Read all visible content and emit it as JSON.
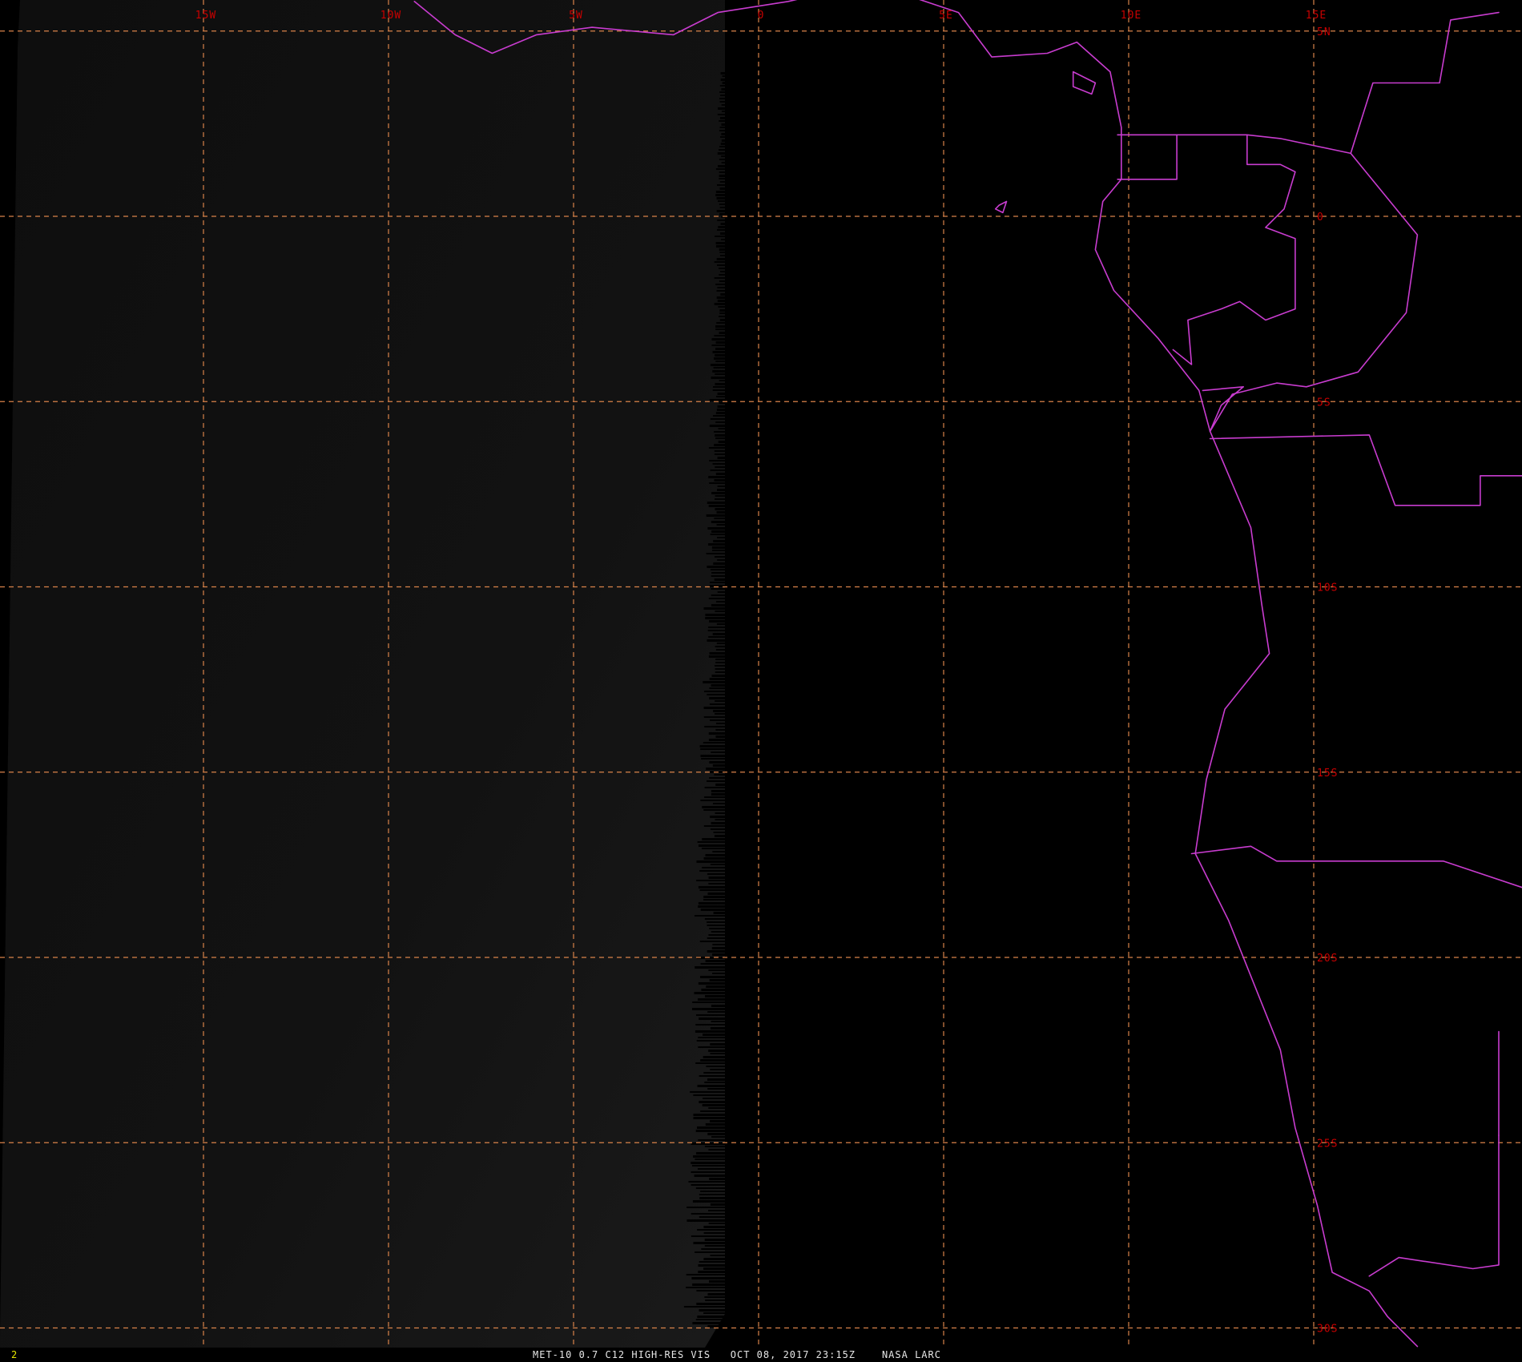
{
  "viewer": {
    "frame_number": "2",
    "caption": {
      "product": "MET-10 0.7 C12 HIGH-RES VIS",
      "datetime": "OCT 08, 2017 23:15Z",
      "source": "NASA LARC"
    }
  },
  "map": {
    "longitude_lines": [
      {
        "value": -15,
        "label": "15W"
      },
      {
        "value": -10,
        "label": "10W"
      },
      {
        "value": -5,
        "label": "5W"
      },
      {
        "value": 0,
        "label": "0"
      },
      {
        "value": 5,
        "label": "5E"
      },
      {
        "value": 10,
        "label": "10E"
      },
      {
        "value": 15,
        "label": "15E"
      }
    ],
    "latitude_lines": [
      {
        "value": 5,
        "label": "5N"
      },
      {
        "value": 0,
        "label": "0"
      },
      {
        "value": -5,
        "label": "5S"
      },
      {
        "value": -10,
        "label": "10S"
      },
      {
        "value": -15,
        "label": "15S"
      },
      {
        "value": -20,
        "label": "20S"
      },
      {
        "value": -25,
        "label": "25S"
      },
      {
        "value": -30,
        "label": "30S"
      }
    ],
    "colors": {
      "background": "#000000",
      "grid_line": "#d9834a",
      "grid_label": "#c80000",
      "boundary": "#c83ccf",
      "night_terminator": "#141414",
      "footer_text": "#e6e6e6",
      "frame_number": "#e6e600"
    },
    "boundaries": [
      {
        "name": "west-africa-coast",
        "points": [
          [
            -9.3,
            5.8
          ],
          [
            -8.2,
            4.9
          ],
          [
            -7.2,
            4.4
          ],
          [
            -6.0,
            4.9
          ],
          [
            -4.5,
            5.1
          ],
          [
            -2.3,
            4.9
          ],
          [
            -1.1,
            5.5
          ],
          [
            0.8,
            5.8
          ],
          [
            3.0,
            6.3
          ],
          [
            5.4,
            5.5
          ],
          [
            6.3,
            4.3
          ],
          [
            7.8,
            4.4
          ],
          [
            8.6,
            4.7
          ],
          [
            9.5,
            3.9
          ],
          [
            9.8,
            2.4
          ],
          [
            9.8,
            1.0
          ],
          [
            9.3,
            0.4
          ],
          [
            9.1,
            -0.9
          ],
          [
            9.6,
            -2.0
          ],
          [
            10.8,
            -3.3
          ],
          [
            11.9,
            -4.7
          ],
          [
            12.2,
            -5.8
          ],
          [
            13.3,
            -8.4
          ],
          [
            13.6,
            -10.5
          ],
          [
            13.8,
            -11.8
          ],
          [
            12.6,
            -13.3
          ],
          [
            12.1,
            -15.2
          ],
          [
            11.8,
            -17.2
          ],
          [
            12.7,
            -19.0
          ],
          [
            14.1,
            -22.5
          ],
          [
            14.5,
            -24.6
          ],
          [
            15.1,
            -26.7
          ],
          [
            15.5,
            -28.5
          ],
          [
            16.5,
            -29.0
          ],
          [
            17.0,
            -29.7
          ],
          [
            17.8,
            -30.5
          ]
        ]
      },
      {
        "name": "bioko-island",
        "points": [
          [
            8.5,
            3.9
          ],
          [
            9.1,
            3.6
          ],
          [
            9.0,
            3.3
          ],
          [
            8.5,
            3.5
          ],
          [
            8.5,
            3.9
          ]
        ]
      },
      {
        "name": "sao-tome-island",
        "points": [
          [
            6.5,
            0.3
          ],
          [
            6.7,
            0.4
          ],
          [
            6.6,
            0.1
          ],
          [
            6.4,
            0.2
          ],
          [
            6.5,
            0.3
          ]
        ]
      },
      {
        "name": "cameroon-eq-guinea-border",
        "points": [
          [
            9.7,
            2.2
          ],
          [
            11.3,
            2.2
          ],
          [
            11.3,
            1.0
          ],
          [
            9.7,
            1.0
          ]
        ]
      },
      {
        "name": "gabon-cameroon-border",
        "points": [
          [
            11.3,
            2.2
          ],
          [
            13.2,
            2.2
          ],
          [
            14.1,
            2.1
          ],
          [
            16.0,
            1.7
          ]
        ]
      },
      {
        "name": "gabon-congo-border",
        "points": [
          [
            13.2,
            2.2
          ],
          [
            13.2,
            1.4
          ],
          [
            14.1,
            1.4
          ],
          [
            14.5,
            1.2
          ],
          [
            14.2,
            0.2
          ],
          [
            13.7,
            -0.3
          ],
          [
            14.5,
            -0.6
          ],
          [
            14.5,
            -2.5
          ],
          [
            13.7,
            -2.8
          ],
          [
            13.0,
            -2.3
          ],
          [
            12.5,
            -2.5
          ],
          [
            11.6,
            -2.8
          ],
          [
            11.7,
            -4.0
          ],
          [
            11.2,
            -3.6
          ]
        ]
      },
      {
        "name": "cameroon-car-congo-border",
        "points": [
          [
            16.0,
            1.7
          ],
          [
            16.6,
            3.6
          ],
          [
            18.4,
            3.6
          ],
          [
            18.7,
            5.3
          ],
          [
            20.0,
            5.5
          ]
        ]
      },
      {
        "name": "congo-drc-border",
        "points": [
          [
            16.0,
            1.7
          ],
          [
            17.8,
            -0.5
          ],
          [
            17.5,
            -2.6
          ],
          [
            16.2,
            -4.2
          ],
          [
            14.8,
            -4.6
          ],
          [
            14.0,
            -4.5
          ],
          [
            12.8,
            -4.8
          ],
          [
            12.2,
            -5.8
          ]
        ]
      },
      {
        "name": "cabinda-border",
        "points": [
          [
            12.0,
            -4.7
          ],
          [
            13.1,
            -4.6
          ],
          [
            12.5,
            -5.1
          ],
          [
            12.2,
            -5.8
          ]
        ]
      },
      {
        "name": "angola-drc-border",
        "points": [
          [
            12.2,
            -6.0
          ],
          [
            16.5,
            -5.9
          ],
          [
            17.2,
            -7.8
          ],
          [
            19.5,
            -7.8
          ],
          [
            19.5,
            -7.0
          ],
          [
            21.8,
            -7.0
          ]
        ]
      },
      {
        "name": "angola-namibia-border",
        "points": [
          [
            11.7,
            -17.2
          ],
          [
            13.3,
            -17.0
          ],
          [
            14.0,
            -17.4
          ],
          [
            18.5,
            -17.4
          ],
          [
            20.9,
            -18.2
          ],
          [
            23.5,
            -18.5
          ]
        ]
      },
      {
        "name": "namibia-botswana-border",
        "points": [
          [
            20.0,
            -22.0
          ],
          [
            20.0,
            -24.8
          ]
        ]
      },
      {
        "name": "namibia-south-africa-border",
        "points": [
          [
            20.0,
            -24.8
          ],
          [
            20.0,
            -28.3
          ],
          [
            19.3,
            -28.4
          ],
          [
            17.3,
            -28.1
          ],
          [
            16.5,
            -28.6
          ]
        ]
      }
    ]
  }
}
